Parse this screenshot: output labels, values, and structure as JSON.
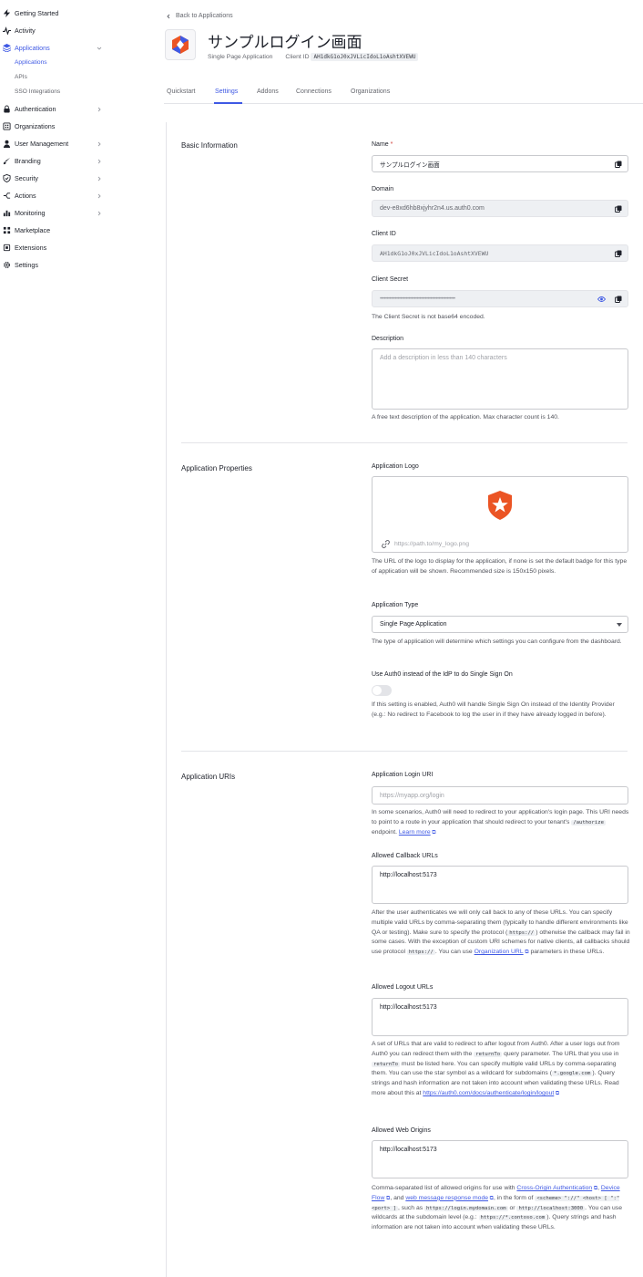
{
  "sidebar": {
    "items": [
      {
        "key": "getting-started",
        "label": "Getting Started",
        "icon": "bolt-icon"
      },
      {
        "key": "activity",
        "label": "Activity",
        "icon": "activity-icon"
      },
      {
        "key": "applications",
        "label": "Applications",
        "icon": "applications-icon",
        "active": true,
        "expanded": true
      },
      {
        "key": "authentication",
        "label": "Authentication",
        "icon": "lock-icon"
      },
      {
        "key": "organizations",
        "label": "Organizations",
        "icon": "organizations-icon"
      },
      {
        "key": "user-management",
        "label": "User Management",
        "icon": "user-icon"
      },
      {
        "key": "branding",
        "label": "Branding",
        "icon": "brush-icon"
      },
      {
        "key": "security",
        "label": "Security",
        "icon": "shield-icon"
      },
      {
        "key": "actions",
        "label": "Actions",
        "icon": "actions-icon"
      },
      {
        "key": "monitoring",
        "label": "Monitoring",
        "icon": "bar-chart-icon"
      },
      {
        "key": "marketplace",
        "label": "Marketplace",
        "icon": "grid-icon"
      },
      {
        "key": "extensions",
        "label": "Extensions",
        "icon": "extensions-icon"
      },
      {
        "key": "settings",
        "label": "Settings",
        "icon": "gear-icon"
      }
    ],
    "subitems": [
      {
        "label": "Applications",
        "active": true
      },
      {
        "label": "APIs"
      },
      {
        "label": "SSO Integrations"
      }
    ]
  },
  "header": {
    "back_label": "Back to Applications",
    "app_name": "サンプルログイン画面",
    "app_type": "Single Page Application",
    "client_id_label": "Client ID",
    "client_id": "AH1dkG1oJ0xJVLicIdoL1oAshtXVEWU"
  },
  "tabs": [
    "Quickstart",
    "Settings",
    "Addons",
    "Connections",
    "Organizations"
  ],
  "active_tab": "Settings",
  "sections": {
    "basic": {
      "title": "Basic Information",
      "name_label": "Name",
      "name_required": "*",
      "name_value": "サンプルログイン画面",
      "domain_label": "Domain",
      "domain_value": "dev-e8xd6hb8xjyhr2n4.us.auth0.com",
      "client_id_label": "Client ID",
      "client_id_value": "AH1dkG1oJ0xJVLicIdoL1oAshtXVEWU",
      "client_secret_label": "Client Secret",
      "client_secret_value": "•••••••••••••••••••••••••••••••••••••••••••••••••••••••",
      "client_secret_help": "The Client Secret is not base64 encoded.",
      "description_label": "Description",
      "description_placeholder": "Add a description in less than 140 characters",
      "description_help": "A free text description of the application. Max character count is 140."
    },
    "properties": {
      "title": "Application Properties",
      "logo_label": "Application Logo",
      "logo_placeholder": "https://path.to/my_logo.png",
      "logo_help": "The URL of the logo to display for the application, if none is set the default badge for this type of application will be shown. Recommended size is 150x150 pixels.",
      "type_label": "Application Type",
      "type_value": "Single Page Application",
      "type_help": "The type of application will determine which settings you can configure from the dashboard.",
      "sso_label": "Use Auth0 instead of the IdP to do Single Sign On",
      "sso_enabled": false,
      "sso_help": "If this setting is enabled, Auth0 will handle Single Sign On instead of the Identity Provider (e.g.: No redirect to Facebook to log the user in if they have already logged in before)."
    },
    "uris": {
      "title": "Application URIs",
      "login_label": "Application Login URI",
      "login_placeholder": "https://myapp.org/login",
      "login_help_1": "In some scenarios, Auth0 will need to redirect to your application's login page. This URI needs to point to a route in your application that should redirect to your tenant's",
      "login_help_code": "/authorize",
      "login_help_2": "endpoint.",
      "login_help_link": "Learn more",
      "callback_label": "Allowed Callback URLs",
      "callback_value": "http://localhost:5173",
      "callback_help_1": "After the user authenticates we will only call back to any of these URLs. You can specify multiple valid URLs by comma-separating them (typically to handle different environments like QA or testing). Make sure to specify the protocol (",
      "callback_help_code1": "https://",
      "callback_help_2": ") otherwise the callback may fail in some cases. With the exception of custom URI schemes for native clients, all callbacks should use protocol",
      "callback_help_code2": "https://",
      "callback_help_3": ". You can use",
      "callback_help_link": "Organization URL",
      "callback_help_4": "parameters in these URLs.",
      "logout_label": "Allowed Logout URLs",
      "logout_value": "http://localhost:5173",
      "logout_help_1": "A set of URLs that are valid to redirect to after logout from Auth0. After a user logs out from Auth0 you can redirect them with the",
      "logout_help_code1": "returnTo",
      "logout_help_2": "query parameter. The URL that you use in",
      "logout_help_code2": "returnTo",
      "logout_help_3": "must be listed here. You can specify multiple valid URLs by comma-separating them. You can use the star symbol as a wildcard for subdomains (",
      "logout_help_code3": "*.google.com",
      "logout_help_4": "). Query strings and hash information are not taken into account when validating these URLs. Read more about this at",
      "logout_help_link": "https://auth0.com/docs/authenticate/login/logout",
      "origins_label": "Allowed Web Origins",
      "origins_value": "http://localhost:5173",
      "origins_help_1": "Comma-separated list of allowed origins for use with",
      "origins_help_link1": "Cross-Origin Authentication",
      "origins_help_sep": ",",
      "origins_help_link2": "Device Flow",
      "origins_help_and": ", and",
      "origins_help_link3": "web message response mode",
      "origins_help_2": ", in the form of",
      "origins_help_code1": "<scheme> \"://\" <host> [ \":\" <port> ]",
      "origins_help_3": ", such as",
      "origins_help_code2": "https://login.mydomain.com",
      "origins_help_or": "or",
      "origins_help_code3": "http://localhost:3000",
      "origins_help_4": ". You can use wildcards at the subdomain level (e.g.:",
      "origins_help_code4": "https://*.contoso.com",
      "origins_help_5": "). Query strings and hash information are not taken into account when validating these URLs."
    }
  },
  "colors": {
    "accent": "#3f59e4",
    "brand_orange": "#eb5424"
  }
}
